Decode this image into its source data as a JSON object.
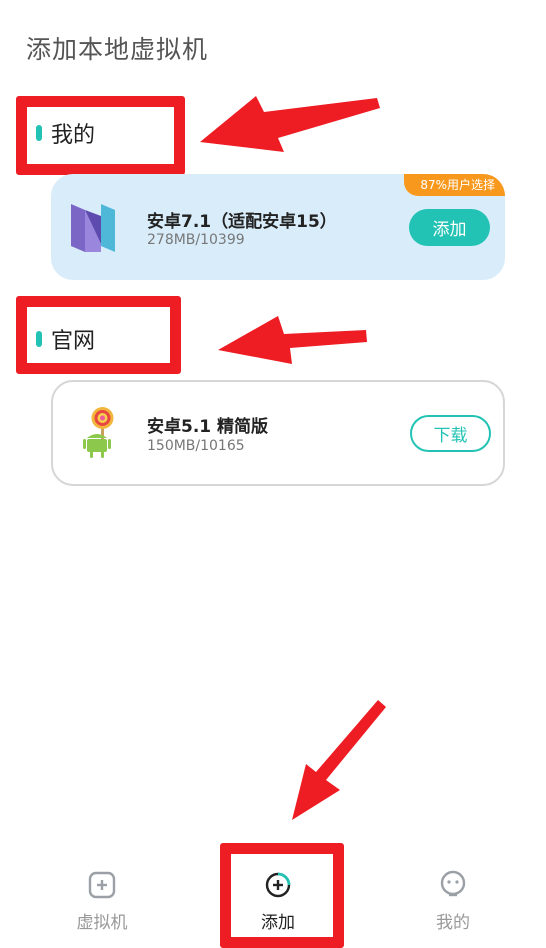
{
  "page": {
    "title": "添加本地虚拟机"
  },
  "sections": {
    "mine": {
      "label": "我的"
    },
    "official": {
      "label": "官网"
    }
  },
  "cards": {
    "mine": {
      "name": "安卓7.1（适配安卓15）",
      "size": "278MB/10399",
      "badge": "87%用户选择",
      "button_label": "添加",
      "icon": "android-nougat-logo-icon"
    },
    "official": {
      "name": "安卓5.1 精简版",
      "size": "150MB/10165",
      "button_label": "下载",
      "icon": "android-lollipop-icon"
    }
  },
  "tabbar": {
    "tabs": [
      {
        "label": "虚拟机",
        "icon": "vm-box-icon",
        "active": false
      },
      {
        "label": "添加",
        "icon": "add-circle-icon",
        "active": true
      },
      {
        "label": "我的",
        "icon": "profile-face-icon",
        "active": false
      }
    ]
  },
  "colors": {
    "accent": "#22c3b4",
    "badge": "#f8991d",
    "annotation": "#ee1c23",
    "card_highlight_bg": "#d8ecfa"
  }
}
